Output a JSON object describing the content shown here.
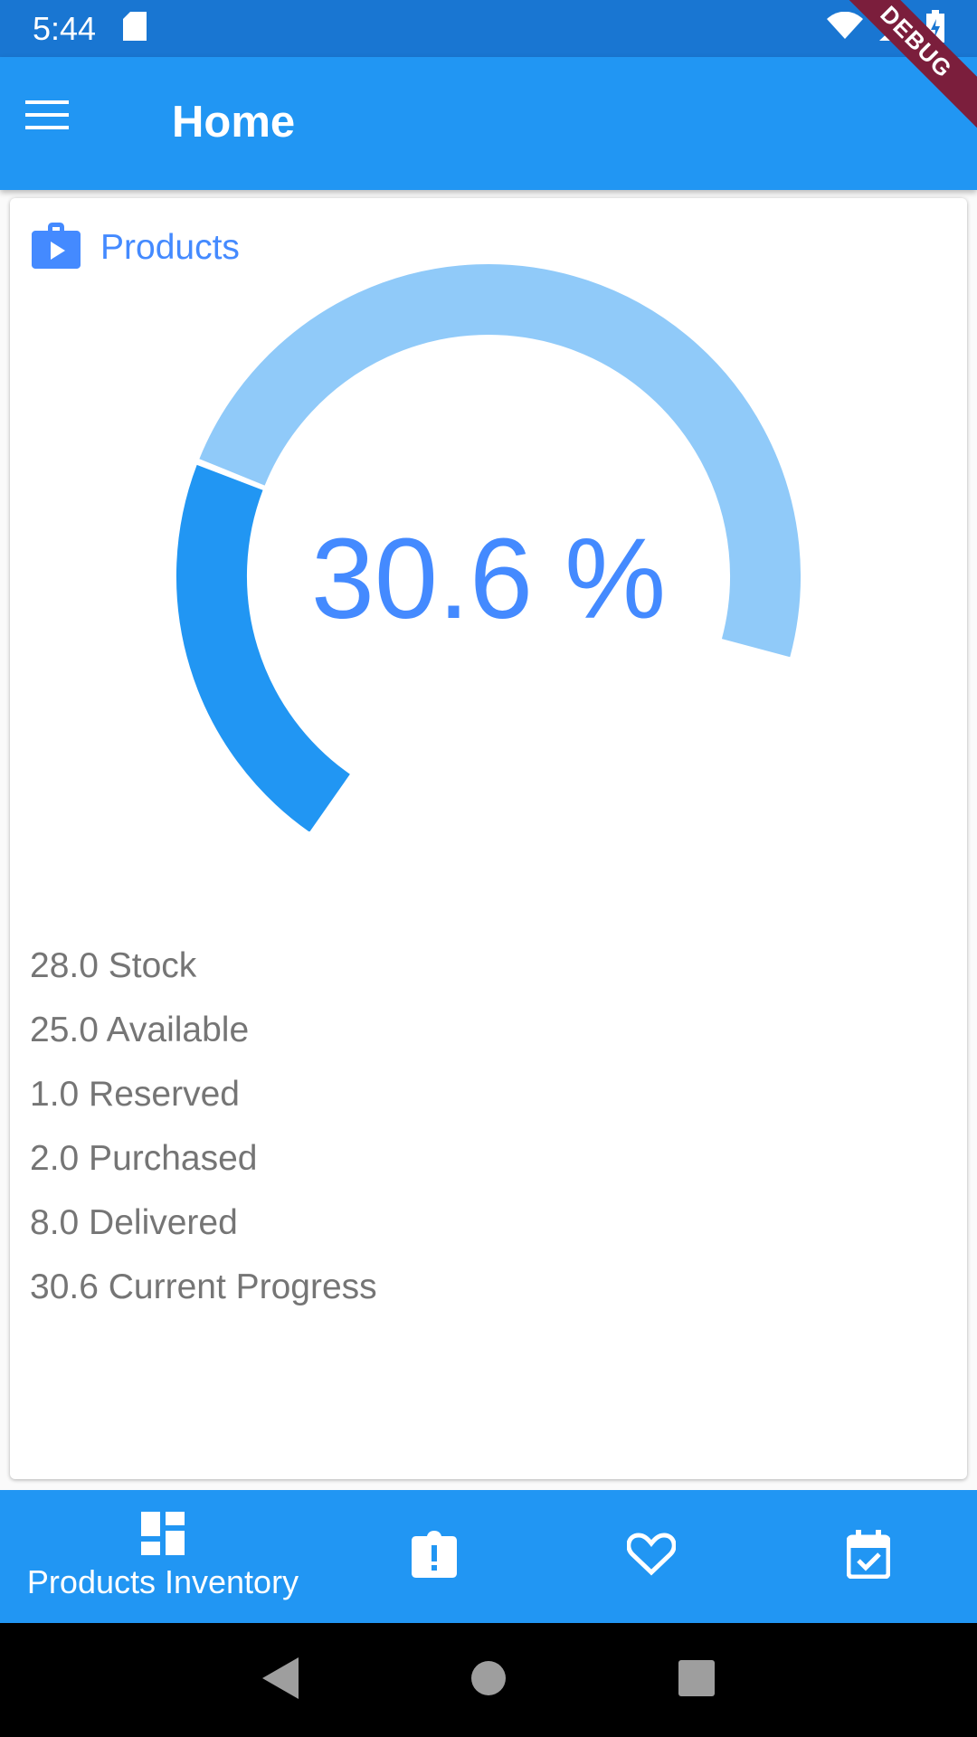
{
  "status_bar": {
    "time": "5:44",
    "icons": [
      "sd-card-icon",
      "wifi-icon",
      "signal-icon",
      "battery-charging-icon"
    ]
  },
  "app_bar": {
    "title": "Home",
    "menu_icon": "menu-icon",
    "debug_label": "DEBUG"
  },
  "card": {
    "title": "Products",
    "icon": "shopping-bag-icon",
    "gauge": {
      "value_text": "30.6 %",
      "progress_fraction": 0.306,
      "track_color": "#90caf9",
      "fill_color": "#2196f3"
    },
    "stats": [
      "28.0 Stock",
      "25.0 Available",
      "1.0 Reserved",
      "2.0 Purchased",
      "8.0 Delivered",
      "30.6 Current Progress"
    ]
  },
  "bottom_nav": {
    "items": [
      {
        "label": "Products Inventory",
        "icon": "dashboard-icon"
      },
      {
        "label": "",
        "icon": "alert-clipboard-icon"
      },
      {
        "label": "",
        "icon": "heart-icon"
      },
      {
        "label": "",
        "icon": "calendar-check-icon"
      }
    ]
  },
  "colors": {
    "primary": "#2196f3",
    "primary_dark": "#1976d2",
    "accent": "#448aff",
    "text_secondary": "#757575"
  }
}
